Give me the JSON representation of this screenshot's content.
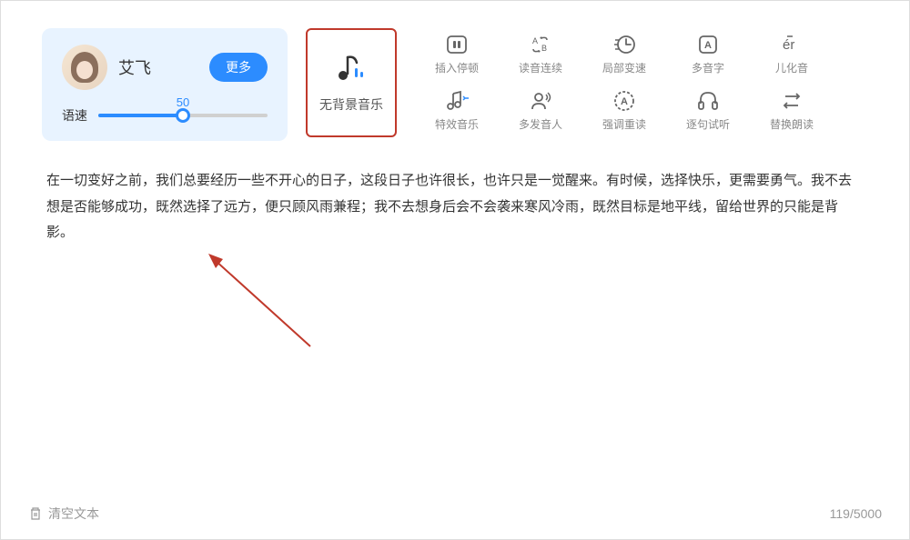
{
  "voice_card": {
    "name": "艾飞",
    "more_label": "更多",
    "speed_label": "语速",
    "speed_value": "50"
  },
  "bgm": {
    "label": "无背景音乐"
  },
  "tools": {
    "row1": [
      {
        "id": "insert-pause",
        "label": "插入停顿"
      },
      {
        "id": "reading-continuous",
        "label": "读音连续"
      },
      {
        "id": "local-speed",
        "label": "局部变速"
      },
      {
        "id": "polyphone",
        "label": "多音字"
      },
      {
        "id": "erhua",
        "label": "儿化音"
      }
    ],
    "row2": [
      {
        "id": "sfx-music",
        "label": "特效音乐"
      },
      {
        "id": "multi-speaker",
        "label": "多发音人"
      },
      {
        "id": "emphasis-reread",
        "label": "强调重读"
      },
      {
        "id": "sentence-preview",
        "label": "逐句试听"
      },
      {
        "id": "replace-read",
        "label": "替换朗读"
      }
    ]
  },
  "text_content": "在一切变好之前，我们总要经历一些不开心的日子，这段日子也许很长，也许只是一觉醒来。有时候，选择快乐，更需要勇气。我不去想是否能够成功，既然选择了远方，便只顾风雨兼程；我不去想身后会不会袭来寒风冷雨，既然目标是地平线，留给世界的只能是背影。",
  "bottom": {
    "clear_label": "清空文本",
    "count": "119/5000"
  },
  "colors": {
    "primary": "#2c8cff",
    "accent_border": "#c0392b",
    "muted": "#888"
  }
}
